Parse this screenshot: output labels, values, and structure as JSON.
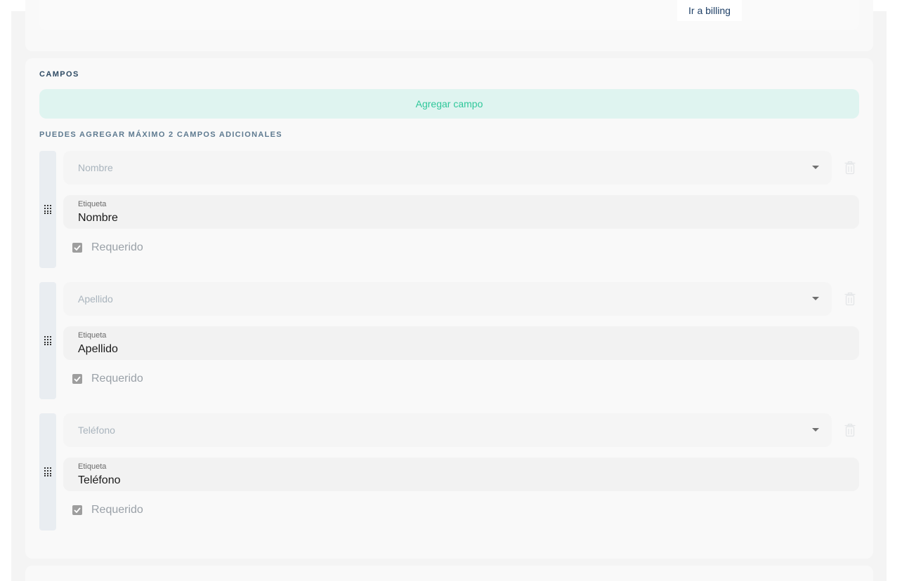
{
  "header": {
    "billing_link": "Ir a billing"
  },
  "fields_section": {
    "title": "CAMPOS",
    "add_button": "Agregar campo",
    "hint": "PUEDES AGREGAR MÁXIMO 2 CAMPOS ADICIONALES",
    "fields": [
      {
        "type": "Nombre",
        "label_caption": "Etiqueta",
        "label_value": "Nombre",
        "required_label": "Requerido",
        "required": true
      },
      {
        "type": "Apellido",
        "label_caption": "Etiqueta",
        "label_value": "Apellido",
        "required_label": "Requerido",
        "required": true
      },
      {
        "type": "Teléfono",
        "label_caption": "Etiqueta",
        "label_value": "Teléfono",
        "required_label": "Requerido",
        "required": true
      }
    ]
  }
}
